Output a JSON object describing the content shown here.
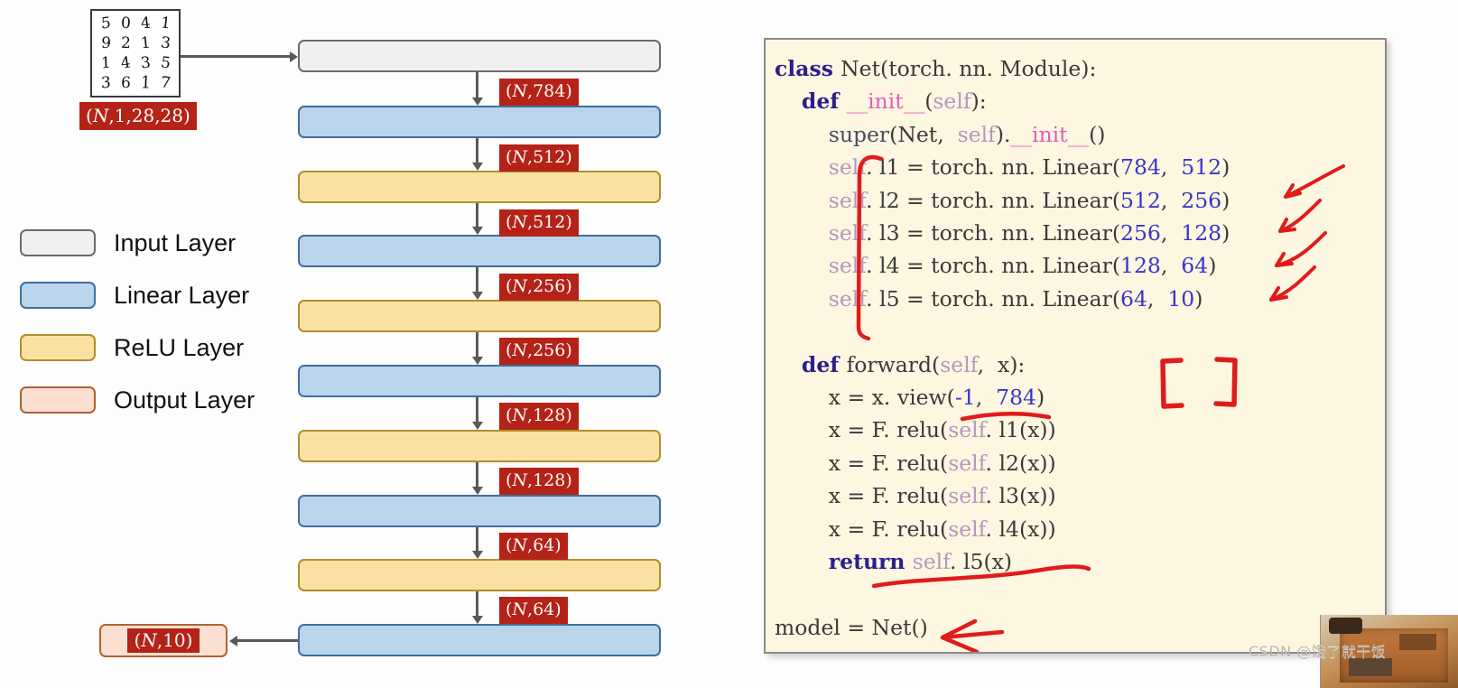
{
  "diagram": {
    "input_image": {
      "name": "mnist-digit-grid",
      "rows": [
        [
          "5",
          "0",
          "4",
          "1"
        ],
        [
          "9",
          "2",
          "1",
          "3"
        ],
        [
          "1",
          "4",
          "3",
          "5"
        ],
        [
          "3",
          "6",
          "1",
          "7"
        ]
      ],
      "shape_label": "(N,1,28,28)"
    },
    "layers": [
      {
        "type": "input",
        "label": "",
        "shape_out": "(N,784)"
      },
      {
        "type": "linear",
        "label": "",
        "shape_out": "(N,512)"
      },
      {
        "type": "relu",
        "label": "",
        "shape_out": "(N,512)"
      },
      {
        "type": "linear",
        "label": "",
        "shape_out": "(N,256)"
      },
      {
        "type": "relu",
        "label": "",
        "shape_out": "(N,256)"
      },
      {
        "type": "linear",
        "label": "",
        "shape_out": "(N,128)"
      },
      {
        "type": "relu",
        "label": "",
        "shape_out": "(N,128)"
      },
      {
        "type": "linear",
        "label": "",
        "shape_out": "(N,64)"
      },
      {
        "type": "relu",
        "label": "",
        "shape_out": "(N,64)"
      },
      {
        "type": "linear",
        "label": "",
        "shape_out": ""
      }
    ],
    "output": {
      "shape_label": "(N,10)"
    },
    "legend": [
      {
        "key": "input",
        "label": "Input Layer",
        "fill": "#f0f0f0",
        "border": "#6b6b6b"
      },
      {
        "key": "linear",
        "label": "Linear Layer",
        "fill": "#bad5eb",
        "border": "#3f6f9e"
      },
      {
        "key": "relu",
        "label": "ReLU Layer",
        "fill": "#fae1a2",
        "border": "#b08f2b"
      },
      {
        "key": "output",
        "label": "Output Layer",
        "fill": "#fbe0d2",
        "border": "#b0622f"
      }
    ]
  },
  "code_panel": {
    "background": "#fdf6e0",
    "annotation_color": "#e01b1b",
    "lines": [
      {
        "id": "l01",
        "tokens": [
          {
            "t": "class ",
            "c": "kw"
          },
          {
            "t": "Net(torch. nn. Module):",
            "c": "plain"
          }
        ]
      },
      {
        "id": "l02",
        "tokens": [
          {
            "t": "    ",
            "c": "plain"
          },
          {
            "t": "def ",
            "c": "kw"
          },
          {
            "t": "__init__",
            "c": "dunder"
          },
          {
            "t": "(",
            "c": "plain"
          },
          {
            "t": "self",
            "c": "self"
          },
          {
            "t": "):",
            "c": "plain"
          }
        ]
      },
      {
        "id": "l03",
        "tokens": [
          {
            "t": "        ",
            "c": "plain"
          },
          {
            "t": "super",
            "c": "name"
          },
          {
            "t": "(Net,  ",
            "c": "plain"
          },
          {
            "t": "self",
            "c": "self"
          },
          {
            "t": ").",
            "c": "plain"
          },
          {
            "t": "__init__",
            "c": "dunder"
          },
          {
            "t": "()",
            "c": "plain"
          }
        ]
      },
      {
        "id": "l04",
        "tokens": [
          {
            "t": "        ",
            "c": "plain"
          },
          {
            "t": "self",
            "c": "self"
          },
          {
            "t": ". l1 = torch. nn. Linear(",
            "c": "plain"
          },
          {
            "t": "784",
            "c": "num"
          },
          {
            "t": ",  ",
            "c": "plain"
          },
          {
            "t": "512",
            "c": "num"
          },
          {
            "t": ")",
            "c": "plain"
          }
        ]
      },
      {
        "id": "l05",
        "tokens": [
          {
            "t": "        ",
            "c": "plain"
          },
          {
            "t": "self",
            "c": "self"
          },
          {
            "t": ". l2 = torch. nn. Linear(",
            "c": "plain"
          },
          {
            "t": "512",
            "c": "num"
          },
          {
            "t": ",  ",
            "c": "plain"
          },
          {
            "t": "256",
            "c": "num"
          },
          {
            "t": ")",
            "c": "plain"
          }
        ]
      },
      {
        "id": "l06",
        "tokens": [
          {
            "t": "        ",
            "c": "plain"
          },
          {
            "t": "self",
            "c": "self"
          },
          {
            "t": ". l3 = torch. nn. Linear(",
            "c": "plain"
          },
          {
            "t": "256",
            "c": "num"
          },
          {
            "t": ",  ",
            "c": "plain"
          },
          {
            "t": "128",
            "c": "num"
          },
          {
            "t": ")",
            "c": "plain"
          }
        ]
      },
      {
        "id": "l07",
        "tokens": [
          {
            "t": "        ",
            "c": "plain"
          },
          {
            "t": "self",
            "c": "self"
          },
          {
            "t": ". l4 = torch. nn. Linear(",
            "c": "plain"
          },
          {
            "t": "128",
            "c": "num"
          },
          {
            "t": ",  ",
            "c": "plain"
          },
          {
            "t": "64",
            "c": "num"
          },
          {
            "t": ")",
            "c": "plain"
          }
        ]
      },
      {
        "id": "l08",
        "tokens": [
          {
            "t": "        ",
            "c": "plain"
          },
          {
            "t": "self",
            "c": "self"
          },
          {
            "t": ". l5 = torch. nn. Linear(",
            "c": "plain"
          },
          {
            "t": "64",
            "c": "num"
          },
          {
            "t": ",  ",
            "c": "plain"
          },
          {
            "t": "10",
            "c": "num"
          },
          {
            "t": ")",
            "c": "plain"
          }
        ]
      },
      {
        "id": "l09",
        "tokens": [
          {
            "t": "",
            "c": "plain"
          }
        ]
      },
      {
        "id": "l10",
        "tokens": [
          {
            "t": "    ",
            "c": "plain"
          },
          {
            "t": "def ",
            "c": "kw"
          },
          {
            "t": "forward(",
            "c": "plain"
          },
          {
            "t": "self",
            "c": "self"
          },
          {
            "t": ",  x):",
            "c": "plain"
          }
        ]
      },
      {
        "id": "l11",
        "tokens": [
          {
            "t": "        x = x. view(",
            "c": "plain"
          },
          {
            "t": "-1",
            "c": "num"
          },
          {
            "t": ",  ",
            "c": "plain"
          },
          {
            "t": "784",
            "c": "num"
          },
          {
            "t": ")",
            "c": "plain"
          }
        ]
      },
      {
        "id": "l12",
        "tokens": [
          {
            "t": "        x = F. relu(",
            "c": "plain"
          },
          {
            "t": "self",
            "c": "self"
          },
          {
            "t": ". l1(x))",
            "c": "plain"
          }
        ]
      },
      {
        "id": "l13",
        "tokens": [
          {
            "t": "        x = F. relu(",
            "c": "plain"
          },
          {
            "t": "self",
            "c": "self"
          },
          {
            "t": ". l2(x))",
            "c": "plain"
          }
        ]
      },
      {
        "id": "l14",
        "tokens": [
          {
            "t": "        x = F. relu(",
            "c": "plain"
          },
          {
            "t": "self",
            "c": "self"
          },
          {
            "t": ". l3(x))",
            "c": "plain"
          }
        ]
      },
      {
        "id": "l15",
        "tokens": [
          {
            "t": "        x = F. relu(",
            "c": "plain"
          },
          {
            "t": "self",
            "c": "self"
          },
          {
            "t": ". l4(x))",
            "c": "plain"
          }
        ]
      },
      {
        "id": "l16",
        "tokens": [
          {
            "t": "        ",
            "c": "plain"
          },
          {
            "t": "return ",
            "c": "kw"
          },
          {
            "t": "self",
            "c": "self"
          },
          {
            "t": ". l5(x)",
            "c": "plain"
          }
        ]
      },
      {
        "id": "l17",
        "tokens": [
          {
            "t": "",
            "c": "plain"
          }
        ]
      },
      {
        "id": "l18",
        "tokens": [
          {
            "t": "model = Net()",
            "c": "plain"
          }
        ]
      }
    ],
    "annotations": [
      {
        "name": "linear-block-bracket",
        "kind": "bracket"
      },
      {
        "name": "dim-link-arrow-784-512",
        "kind": "arrow"
      },
      {
        "name": "dim-link-arrow-512-256",
        "kind": "arrow"
      },
      {
        "name": "dim-link-arrow-256-128",
        "kind": "arrow"
      },
      {
        "name": "dim-link-arrow-128-64",
        "kind": "arrow"
      },
      {
        "name": "view-underline",
        "kind": "underline"
      },
      {
        "name": "shape-brackets",
        "kind": "brackets"
      },
      {
        "name": "return-underline",
        "kind": "underline"
      },
      {
        "name": "model-arrow",
        "kind": "arrow"
      }
    ]
  },
  "watermark": {
    "text": "CSDN @饿了就干饭"
  }
}
